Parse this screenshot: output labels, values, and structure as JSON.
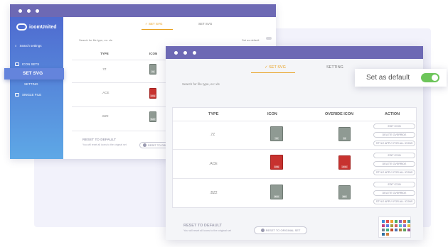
{
  "back": {
    "logo": "ioomUnited",
    "sidebar": {
      "search": "Search settings",
      "items": [
        "ICON SETS",
        "SETTING",
        "SINGLE FILE"
      ]
    },
    "tabs": [
      "SET SVG",
      "SET SVG"
    ],
    "search_placeholder": "Search for file type, ex: xls",
    "set_default": "Set as default",
    "headers": [
      "TYPE",
      "ICON"
    ],
    "rows": [
      {
        "type": ".7Z",
        "icon": "7Z"
      },
      {
        "type": ".ACE",
        "icon": "ACE"
      },
      {
        "type": ".BZ2",
        "icon": "BZ2"
      }
    ],
    "reset_title": "RESET TO DEFAULT",
    "reset_desc": "You will reset all icons to the original set",
    "reset_button": "RESET TO ORIGI"
  },
  "popup_set_svg": "SET SVG",
  "front": {
    "tabs": [
      "SET SVG",
      "SETTING"
    ],
    "search_placeholder": "Search for file type, ex: xls",
    "headers": [
      "TYPE",
      "ICON",
      "OVERIDE ICON",
      "ACTION"
    ],
    "rows": [
      {
        "type": ".7Z",
        "icon": "7Z",
        "override": "7Z"
      },
      {
        "type": ".ACE",
        "icon": "ACE",
        "override": "ACE"
      },
      {
        "type": ".BZ2",
        "icon": "BZ2",
        "override": "BZ2"
      }
    ],
    "actions": [
      "EDIT ICON",
      "DELETE OVERRIDE",
      "STYLE APPLY FOR ALL ICONS"
    ],
    "reset_title": "RESET TO DEFAULT",
    "reset_desc": "You will reset all icons to the original set",
    "reset_button": "RESET TO ORIGINAL SET",
    "palette": [
      "#3d8bd8",
      "#e05050",
      "#f0a030",
      "#50b060",
      "#8a60c0",
      "#e07040",
      "#40a0a0",
      "#c04080",
      "#6080e0",
      "#a0a040",
      "#d06060",
      "#50c0d0",
      "#9070d0",
      "#e0c040",
      "#708090",
      "#40b080",
      "#c05030",
      "#5070b0",
      "#b08040",
      "#60a060",
      "#a05090",
      "#3070a0",
      "#d08040"
    ]
  },
  "default_popup": {
    "label": "Set as default",
    "toggle": "on"
  },
  "colors": {
    "titlebar": "#6d69b4",
    "sidebar_top": "#4f6bd0",
    "accent": "#e8a01e",
    "toggle_on": "#6dc55a"
  }
}
